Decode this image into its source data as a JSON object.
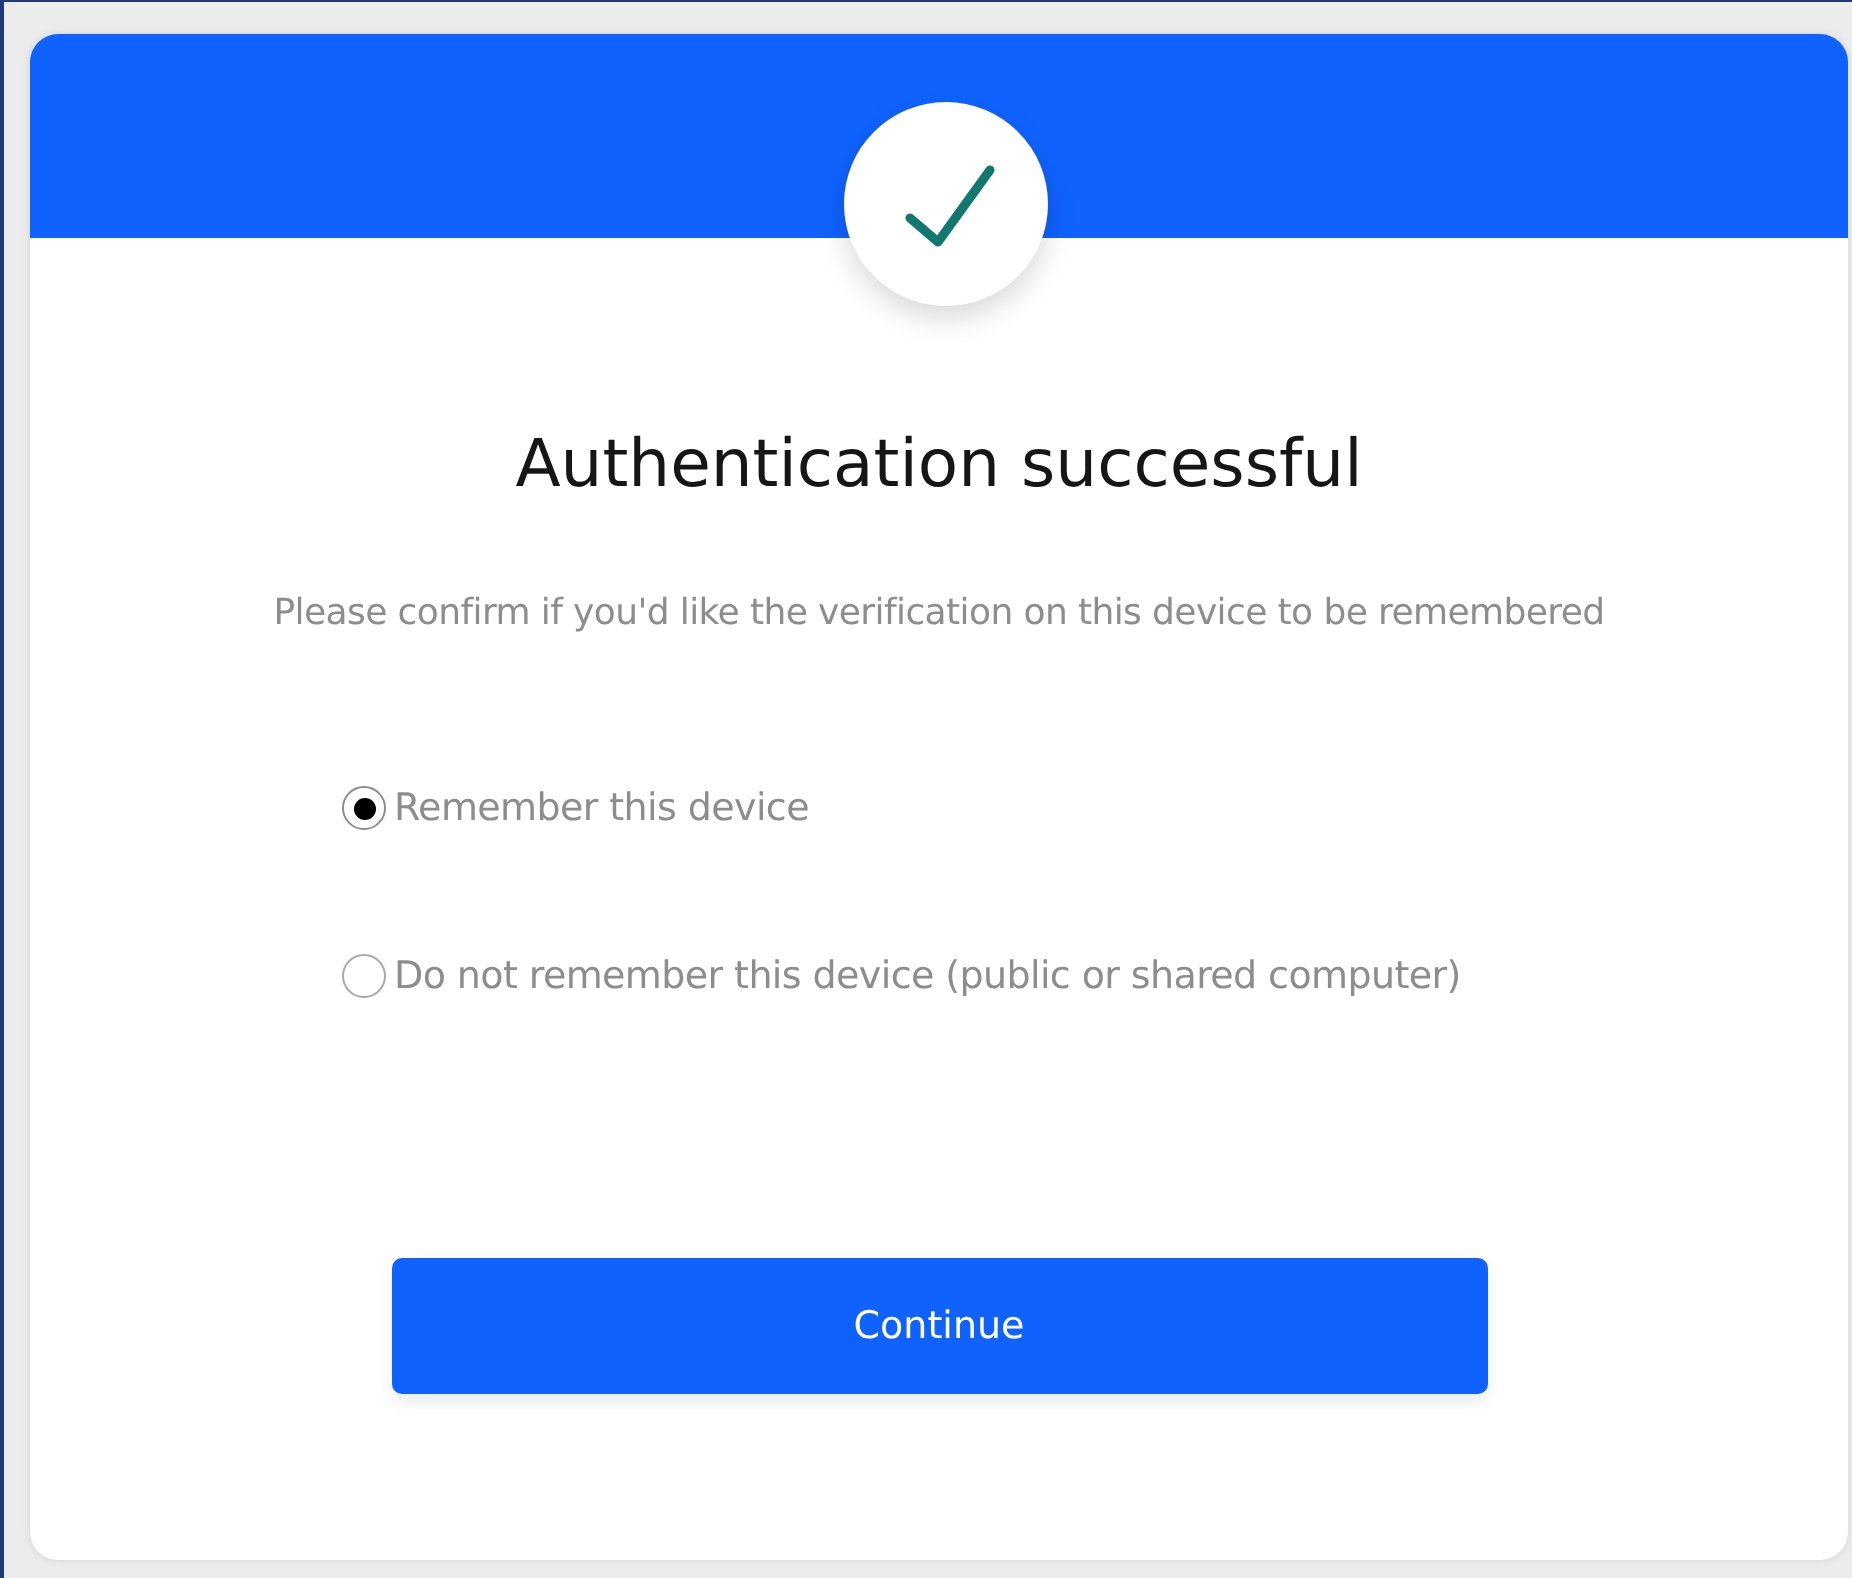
{
  "title": "Authentication successful",
  "message": "Please confirm if you'd like the verification on this device to be remembered",
  "options": [
    {
      "label": "Remember this device",
      "selected": true
    },
    {
      "label": "Do not remember this device (public or shared computer)",
      "selected": false
    }
  ],
  "button": "Continue"
}
